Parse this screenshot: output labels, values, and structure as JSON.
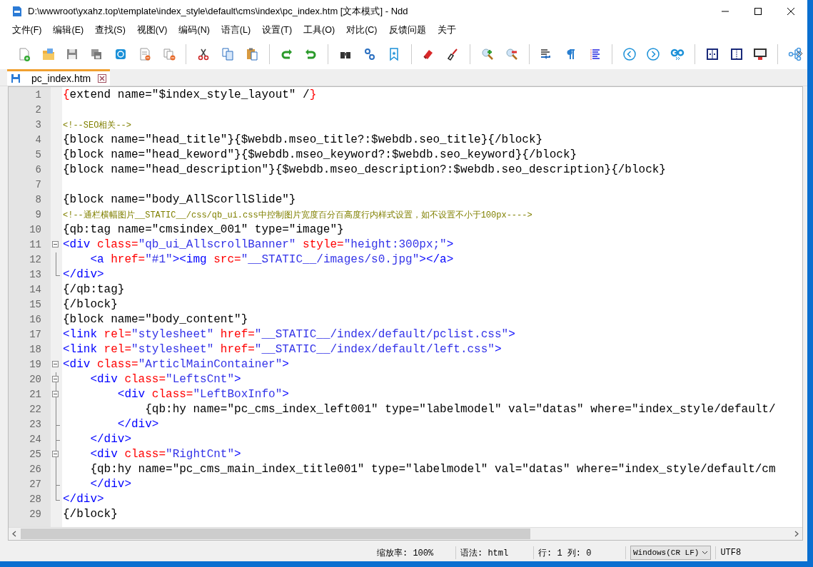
{
  "window": {
    "title": "D:\\wwwroot\\yxahz.top\\template\\index_style\\default\\cms\\index\\pc_index.htm [文本模式] - Ndd"
  },
  "menu": [
    "文件(F)",
    "编辑(E)",
    "查找(S)",
    "视图(V)",
    "编码(N)",
    "语言(L)",
    "设置(T)",
    "工具(O)",
    "对比(C)",
    "反馈问题",
    "关于"
  ],
  "tabs": [
    {
      "label": "pc_index.htm",
      "selected": true
    }
  ],
  "editor": {
    "lines": [
      {
        "number": "1",
        "fold_start": false,
        "in_fold": false,
        "fold_end": false,
        "tokens": [
          {
            "kind": "brace",
            "text": "{"
          },
          {
            "kind": "text",
            "text": "extend name=\"$index_style_layout\" /"
          },
          {
            "kind": "brace",
            "text": "}"
          }
        ]
      },
      {
        "number": "2",
        "fold_start": false,
        "in_fold": false,
        "fold_end": false
      },
      {
        "number": "3",
        "fold_start": false,
        "in_fold": false,
        "fold_end": false,
        "tokens": [
          {
            "kind": "comment",
            "text": "<!--SEO相关-->"
          }
        ]
      },
      {
        "number": "4",
        "fold_start": false,
        "in_fold": false,
        "fold_end": false,
        "tokens": [
          {
            "kind": "text",
            "text": "{block name=\"head_title\"}{$webdb.mseo_title?:$webdb.seo_title}{/block}"
          }
        ]
      },
      {
        "number": "5",
        "fold_start": false,
        "in_fold": false,
        "fold_end": false,
        "tokens": [
          {
            "kind": "text",
            "text": "{block name=\"head_keword\"}{$webdb.mseo_keyword?:$webdb.seo_keyword}{/block}"
          }
        ]
      },
      {
        "number": "6",
        "fold_start": false,
        "in_fold": false,
        "fold_end": false,
        "tokens": [
          {
            "kind": "text",
            "text": "{block name=\"head_description\"}{$webdb.mseo_description?:$webdb.seo_description}{/block}"
          }
        ]
      },
      {
        "number": "7",
        "fold_start": false,
        "in_fold": false,
        "fold_end": false
      },
      {
        "number": "8",
        "fold_start": false,
        "in_fold": false,
        "fold_end": false,
        "tokens": [
          {
            "kind": "text",
            "text": "{block name=\"body_AllScorllSlide\"}"
          }
        ]
      },
      {
        "number": "9",
        "fold_start": false,
        "in_fold": false,
        "fold_end": false,
        "tokens": [
          {
            "kind": "comment",
            "text": "<!--通栏横幅图片__STATIC__/css/qb_ui.css中控制图片宽度百分百高度行内样式设置，如不设置不小于100px---->"
          }
        ]
      },
      {
        "number": "10",
        "fold_start": false,
        "in_fold": false,
        "fold_end": false,
        "tokens": [
          {
            "kind": "text",
            "text": "{qb:tag name=\"cmsindex_001\" type=\"image\"}"
          }
        ]
      },
      {
        "number": "11",
        "fold_start": true,
        "in_fold": false,
        "fold_end": false,
        "tokens": [
          {
            "kind": "tag",
            "text": "<div"
          },
          {
            "kind": "attr",
            "text": " class="
          },
          {
            "kind": "value",
            "text": "\"qb_ui_AllscrollBanner\""
          },
          {
            "kind": "attr",
            "text": " style="
          },
          {
            "kind": "value",
            "text": "\"height:300px;\""
          },
          {
            "kind": "tag",
            "text": ">"
          }
        ]
      },
      {
        "number": "12",
        "fold_start": false,
        "in_fold": true,
        "fold_end": false,
        "tokens": [
          {
            "kind": "tag",
            "text": "    <a"
          },
          {
            "kind": "attr",
            "text": " href="
          },
          {
            "kind": "value",
            "text": "\"#1\""
          },
          {
            "kind": "tag",
            "text": "><img"
          },
          {
            "kind": "attr",
            "text": " src="
          },
          {
            "kind": "value",
            "text": "\"__STATIC__/images/s0.jpg\""
          },
          {
            "kind": "tag",
            "text": "></a>"
          }
        ]
      },
      {
        "number": "13",
        "fold_start": false,
        "in_fold": false,
        "fold_end": true,
        "tokens": [
          {
            "kind": "tag",
            "text": "</div>"
          }
        ]
      },
      {
        "number": "14",
        "fold_start": false,
        "in_fold": false,
        "fold_end": false,
        "tokens": [
          {
            "kind": "text",
            "text": "{/qb:tag}"
          }
        ]
      },
      {
        "number": "15",
        "fold_start": false,
        "in_fold": false,
        "fold_end": false,
        "tokens": [
          {
            "kind": "text",
            "text": "{/block}"
          }
        ]
      },
      {
        "number": "16",
        "fold_start": false,
        "in_fold": false,
        "fold_end": false,
        "tokens": [
          {
            "kind": "text",
            "text": "{block name=\"body_content\"}"
          }
        ]
      },
      {
        "number": "17",
        "fold_start": false,
        "in_fold": false,
        "fold_end": false,
        "tokens": [
          {
            "kind": "tag",
            "text": "<link"
          },
          {
            "kind": "attr",
            "text": " rel="
          },
          {
            "kind": "value",
            "text": "\"stylesheet\""
          },
          {
            "kind": "attr",
            "text": " href="
          },
          {
            "kind": "value",
            "text": "\"__STATIC__/index/default/pclist.css\""
          },
          {
            "kind": "tag",
            "text": ">"
          }
        ]
      },
      {
        "number": "18",
        "fold_start": false,
        "in_fold": false,
        "fold_end": false,
        "tokens": [
          {
            "kind": "tag",
            "text": "<link"
          },
          {
            "kind": "attr",
            "text": " rel="
          },
          {
            "kind": "value",
            "text": "\"stylesheet\""
          },
          {
            "kind": "attr",
            "text": " href="
          },
          {
            "kind": "value",
            "text": "\"__STATIC__/index/default/left.css\""
          },
          {
            "kind": "tag",
            "text": ">"
          }
        ]
      },
      {
        "number": "19",
        "fold_start": true,
        "in_fold": false,
        "fold_end": false,
        "tokens": [
          {
            "kind": "tag",
            "text": "<div"
          },
          {
            "kind": "attr",
            "text": " class="
          },
          {
            "kind": "value",
            "text": "\"ArticlMainContainer\""
          },
          {
            "kind": "tag",
            "text": ">"
          }
        ]
      },
      {
        "number": "20",
        "fold_start": true,
        "in_fold": true,
        "fold_end": false,
        "tokens": [
          {
            "kind": "tag",
            "text": "    <div"
          },
          {
            "kind": "attr",
            "text": " class="
          },
          {
            "kind": "value",
            "text": "\"LeftsCnt\""
          },
          {
            "kind": "tag",
            "text": ">"
          }
        ]
      },
      {
        "number": "21",
        "fold_start": true,
        "in_fold": true,
        "fold_end": false,
        "tokens": [
          {
            "kind": "tag",
            "text": "        <div"
          },
          {
            "kind": "attr",
            "text": " class="
          },
          {
            "kind": "value",
            "text": "\"LeftBoxInfo\""
          },
          {
            "kind": "tag",
            "text": ">"
          }
        ]
      },
      {
        "number": "22",
        "fold_start": false,
        "in_fold": true,
        "fold_end": false,
        "tokens": [
          {
            "kind": "text",
            "text": "            {qb:hy name=\"pc_cms_index_left001\" type=\"labelmodel\" val=\"datas\" where=\"index_style/default/"
          }
        ]
      },
      {
        "number": "23",
        "fold_start": false,
        "in_fold": true,
        "fold_end": true,
        "tokens": [
          {
            "kind": "tag",
            "text": "        </div>"
          }
        ]
      },
      {
        "number": "24",
        "fold_start": false,
        "in_fold": true,
        "fold_end": true,
        "tokens": [
          {
            "kind": "tag",
            "text": "    </div>"
          }
        ]
      },
      {
        "number": "25",
        "fold_start": true,
        "in_fold": true,
        "fold_end": false,
        "tokens": [
          {
            "kind": "tag",
            "text": "    <div"
          },
          {
            "kind": "attr",
            "text": " class="
          },
          {
            "kind": "value",
            "text": "\"RightCnt\""
          },
          {
            "kind": "tag",
            "text": ">"
          }
        ]
      },
      {
        "number": "26",
        "fold_start": false,
        "in_fold": true,
        "fold_end": false,
        "tokens": [
          {
            "kind": "text",
            "text": "    {qb:hy name=\"pc_cms_main_index_title001\" type=\"labelmodel\" val=\"datas\" where=\"index_style/default/cm"
          }
        ]
      },
      {
        "number": "27",
        "fold_start": false,
        "in_fold": true,
        "fold_end": true,
        "tokens": [
          {
            "kind": "tag",
            "text": "    </div>"
          }
        ]
      },
      {
        "number": "28",
        "fold_start": false,
        "in_fold": false,
        "fold_end": true,
        "tokens": [
          {
            "kind": "tag",
            "text": "</div>"
          }
        ]
      },
      {
        "number": "29",
        "fold_start": false,
        "in_fold": false,
        "fold_end": false,
        "tokens": [
          {
            "kind": "text",
            "text": "{/block}"
          }
        ]
      }
    ]
  },
  "status_bar": {
    "zoom": "缩放率: 100%",
    "syntax": "语法: html",
    "position": "行: 1 列: 0",
    "line_ending": "Windows(CR LF)",
    "encoding": "UTF8"
  }
}
